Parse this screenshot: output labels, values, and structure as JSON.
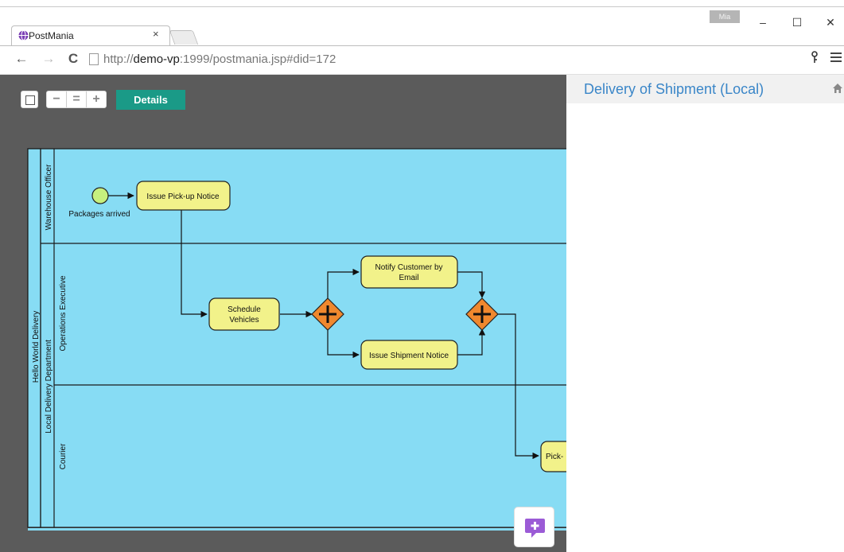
{
  "browser": {
    "user_badge": "Mia",
    "tab_title": "PostMania",
    "tab_close": "×",
    "url_prefix": "http://",
    "url_host": "demo-vp",
    "url_rest": ":1999/postmania.jsp#did=172",
    "controls": {
      "minimize": "–",
      "maximize": "☐",
      "close": "✕"
    },
    "nav": {
      "back": "←",
      "forward": "→",
      "reload": "C"
    },
    "key_icon": "key-icon",
    "menu_icon": "hamburger-icon"
  },
  "toolbar": {
    "zoom_out": "−",
    "zoom_reset": "=",
    "zoom_in": "+",
    "details_label": "Details"
  },
  "panel": {
    "title": "Delivery of Shipment (Local)",
    "home_icon": "home-icon"
  },
  "diagram": {
    "pool": "Hello World Delivery",
    "lanes": {
      "warehouse": "Warehouse Officer",
      "department": "Local Delivery Department",
      "operations": "Operations Executive",
      "courier": "Courier"
    },
    "start_event": "Packages arrived",
    "tasks": {
      "issue_pickup": "Issue Pick-up Notice",
      "schedule_1": "Schedule",
      "schedule_2": "Vehicles",
      "notify_1": "Notify Customer by",
      "notify_2": "Email",
      "issue_shipment": "Issue Shipment Notice",
      "pick": "Pick-"
    },
    "gateway_type": "parallel",
    "colors": {
      "lane_fill": "#87dcf4",
      "task_fill": "#f2f28a",
      "gateway_fill": "#f0882e",
      "start_fill": "#c7ef7e"
    }
  },
  "chat_icon": "chat-plus-icon"
}
